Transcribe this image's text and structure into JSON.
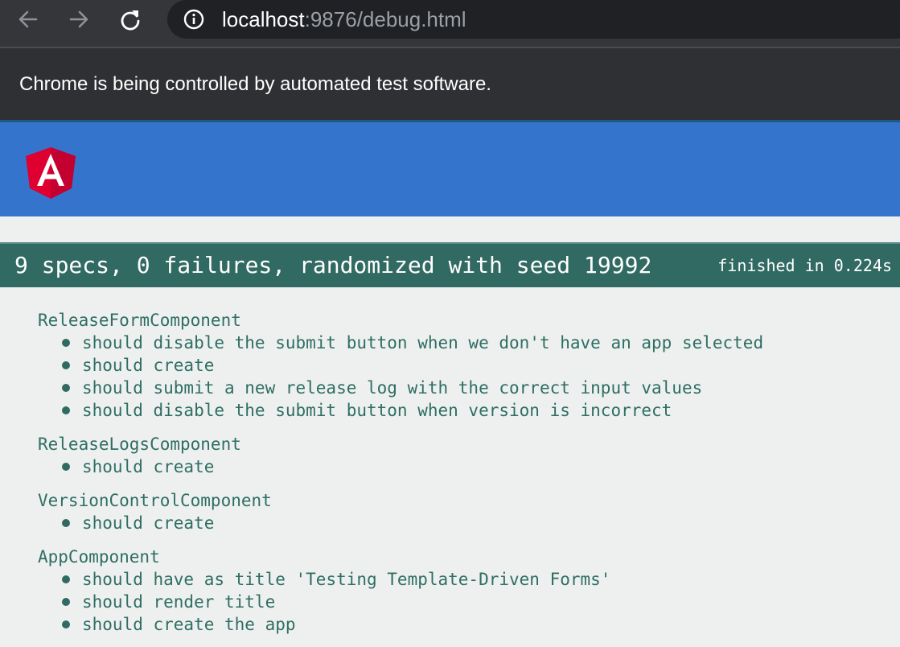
{
  "browser": {
    "url_host": "localhost",
    "url_rest": ":9876/debug.html",
    "infobar_message": "Chrome is being controlled by automated test software."
  },
  "icons": {
    "back": "arrow-left",
    "forward": "arrow-right",
    "reload": "reload",
    "site_info": "info-circle",
    "logo": "angular-logo"
  },
  "colors": {
    "header": "#3574cd",
    "summary_bar": "#316a62",
    "spec_text": "#2e6e63",
    "angular_red": "#dd0031"
  },
  "summary": {
    "text": "9 specs, 0 failures, randomized with seed 19992",
    "duration": "finished in 0.224s"
  },
  "suites": [
    {
      "name": "ReleaseFormComponent",
      "specs": [
        "should disable the submit button when we don't have an app selected",
        "should create",
        "should submit a new release log with the correct input values",
        "should disable the submit button when version is incorrect"
      ]
    },
    {
      "name": "ReleaseLogsComponent",
      "specs": [
        "should create"
      ]
    },
    {
      "name": "VersionControlComponent",
      "specs": [
        "should create"
      ]
    },
    {
      "name": "AppComponent",
      "specs": [
        "should have as title 'Testing Template-Driven Forms'",
        "should render title",
        "should create the app"
      ]
    }
  ]
}
